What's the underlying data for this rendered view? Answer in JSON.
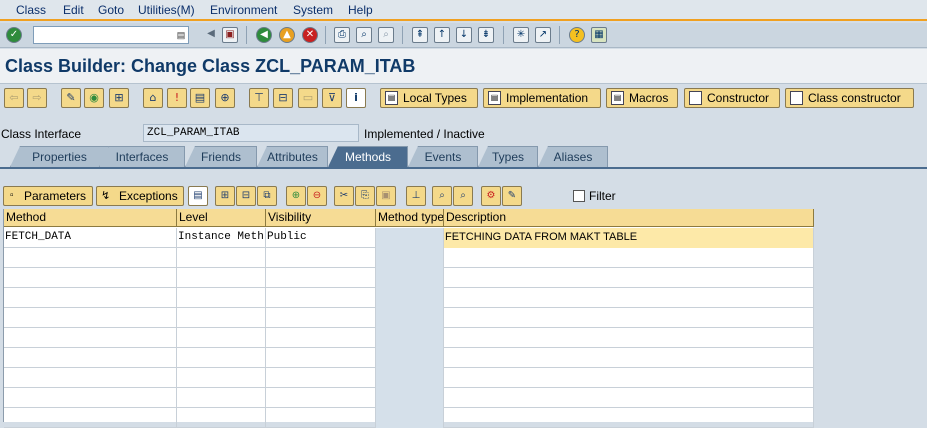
{
  "menu": {
    "items": [
      "Class",
      "Edit",
      "Goto",
      "Utilities(M)",
      "Environment",
      "System",
      "Help"
    ]
  },
  "system_toolbar": {
    "command_field_value": "",
    "icons": [
      "enter-icon",
      "dropdown-icon",
      "back-icon",
      "save-icon",
      "back-nav-icon",
      "exit-icon",
      "cancel-icon",
      "print-icon",
      "find-icon",
      "find-next-icon",
      "first-page-icon",
      "prev-page-icon",
      "next-page-icon",
      "last-page-icon",
      "new-session-icon",
      "shortcut-icon",
      "help-icon",
      "layout-icon"
    ]
  },
  "title": "Class Builder: Change Class ZCL_PARAM_ITAB",
  "app_toolbar": {
    "buttons": [
      {
        "label": "Local Types",
        "icon": "doc-icon"
      },
      {
        "label": "Implementation",
        "icon": "doc-icon"
      },
      {
        "label": "Macros",
        "icon": "doc-icon"
      },
      {
        "label": "Constructor",
        "icon": "page-icon"
      },
      {
        "label": "Class constructor",
        "icon": "page-icon"
      }
    ]
  },
  "header": {
    "class_interface_label": "Class Interface",
    "class_interface_value": "ZCL_PARAM_ITAB",
    "status": "Implemented / Inactive"
  },
  "tabs": [
    {
      "label": "Properties",
      "active": false
    },
    {
      "label": "Interfaces",
      "active": false
    },
    {
      "label": "Friends",
      "active": false
    },
    {
      "label": "Attributes",
      "active": false
    },
    {
      "label": "Methods",
      "active": true
    },
    {
      "label": "Events",
      "active": false
    },
    {
      "label": "Types",
      "active": false
    },
    {
      "label": "Aliases",
      "active": false
    }
  ],
  "grid_toolbar": {
    "parameters_label": "Parameters",
    "exceptions_label": "Exceptions",
    "filter_label": "Filter",
    "filter_checked": false
  },
  "table": {
    "columns": [
      "Method",
      "Level",
      "Visibility",
      "Method type",
      "Description"
    ],
    "rows": [
      {
        "method": "FETCH_DATA",
        "level": "Instance Meth",
        "visibility": "Public",
        "method_type": "",
        "description": "FETCHING DATA FROM MAKT TABLE"
      }
    ]
  },
  "colors": {
    "accent": "#f0a020",
    "title": "#103a68",
    "active_tab": "#4b6c8f",
    "button": "#f4d98a"
  }
}
